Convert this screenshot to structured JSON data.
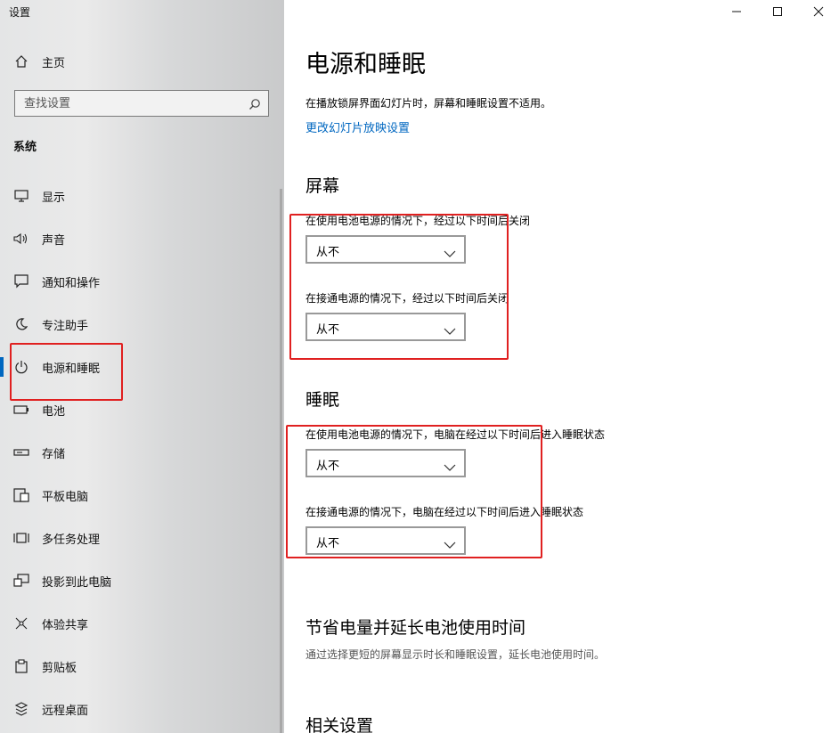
{
  "window": {
    "title": "设置"
  },
  "sidebar": {
    "home": {
      "label": "主页",
      "icon": "home-icon"
    },
    "search": {
      "placeholder": "查找设置",
      "icon": "search-icon"
    },
    "section": "系统",
    "items": [
      {
        "label": "显示",
        "icon": "monitor-icon"
      },
      {
        "label": "声音",
        "icon": "speaker-icon"
      },
      {
        "label": "通知和操作",
        "icon": "message-icon"
      },
      {
        "label": "专注助手",
        "icon": "moon-icon"
      },
      {
        "label": "电源和睡眠",
        "icon": "power-icon",
        "active": true
      },
      {
        "label": "电池",
        "icon": "battery-icon"
      },
      {
        "label": "存储",
        "icon": "storage-icon"
      },
      {
        "label": "平板电脑",
        "icon": "tablet-icon"
      },
      {
        "label": "多任务处理",
        "icon": "multitask-icon"
      },
      {
        "label": "投影到此电脑",
        "icon": "project-icon"
      },
      {
        "label": "体验共享",
        "icon": "share-icon"
      },
      {
        "label": "剪贴板",
        "icon": "clipboard-icon"
      },
      {
        "label": "远程桌面",
        "icon": "remote-desktop-icon"
      }
    ]
  },
  "main": {
    "title": "电源和睡眠",
    "intro": "在播放锁屏界面幻灯片时，屏幕和睡眠设置不适用。",
    "slideshow_link": "更改幻灯片放映设置",
    "screen": {
      "heading": "屏幕",
      "battery_label": "在使用电池电源的情况下，经过以下时间后关闭",
      "battery_value": "从不",
      "plugged_label": "在接通电源的情况下，经过以下时间后关闭",
      "plugged_value": "从不"
    },
    "sleep": {
      "heading": "睡眠",
      "battery_label": "在使用电池电源的情况下，电脑在经过以下时间后进入睡眠状态",
      "battery_value": "从不",
      "plugged_label": "在接通电源的情况下，电脑在经过以下时间后进入睡眠状态",
      "plugged_value": "从不"
    },
    "battery_saving": {
      "heading": "节省电量并延长电池使用时间",
      "desc": "通过选择更短的屏幕显示时长和睡眠设置，延长电池使用时间。"
    },
    "related": {
      "heading": "相关设置"
    }
  },
  "colors": {
    "accent": "#0067c0",
    "annotation": "#e02020"
  }
}
